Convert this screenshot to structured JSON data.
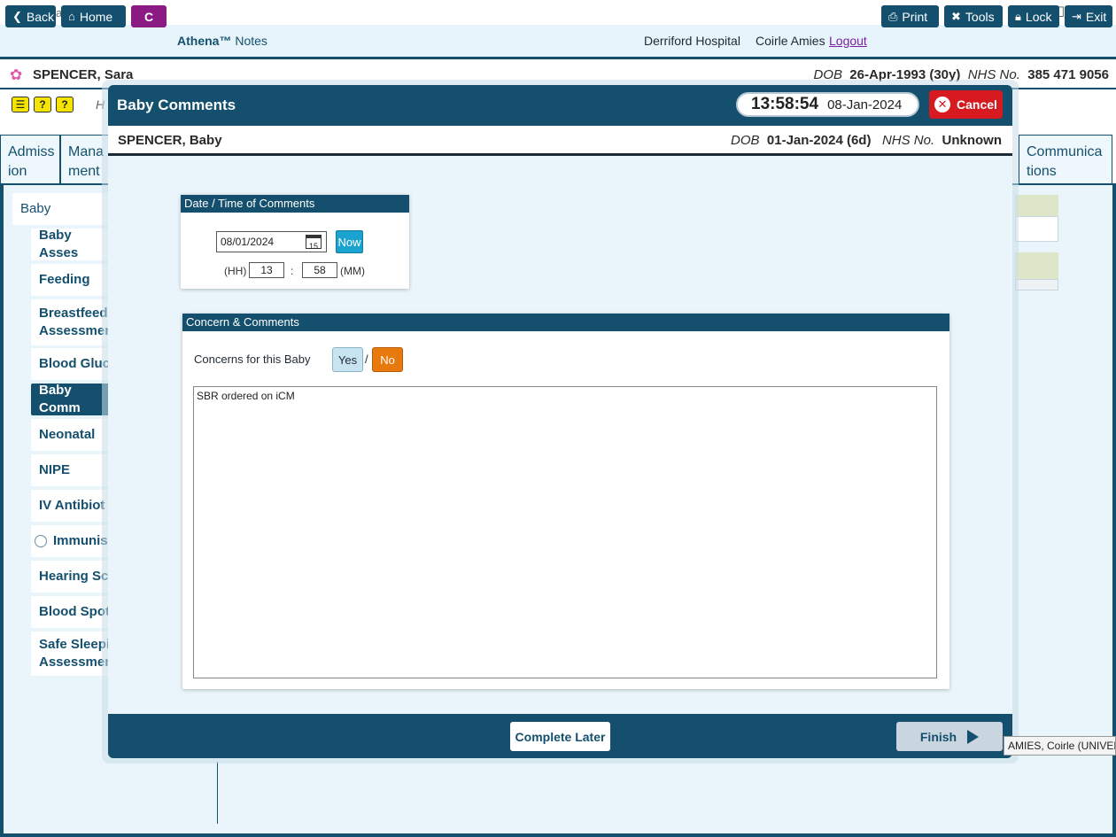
{
  "window": {
    "title": "Athena",
    "minimize": "—",
    "maximize": "☐",
    "close": "✕"
  },
  "toolbar": {
    "back": "Back",
    "home": "Home",
    "c": "C",
    "brand_strong": "Athena™",
    "brand_rest": " Notes",
    "hospital": "Derriford Hospital",
    "user": "Coirle Amies",
    "logout": "Logout",
    "print": "Print",
    "tools": "Tools",
    "lock": "Lock",
    "exit": "Exit"
  },
  "patient": {
    "name": "SPENCER, Sara",
    "dob_label": "DOB",
    "dob": "26-Apr-1993 (30y)",
    "nhs_label": "NHS No.",
    "nhs": "385 471 9056"
  },
  "background": {
    "h_text": "H",
    "tabs": [
      {
        "line1": "Admiss",
        "line2": "ion"
      },
      {
        "line1": "Mana",
        "line2": "ment"
      },
      {
        "line1": "Communica",
        "line2": "tions"
      }
    ],
    "nav": [
      {
        "label": "Baby"
      },
      {
        "label": "Baby Asses"
      },
      {
        "label": "Feeding"
      },
      {
        "label": "Breastfeedi",
        "label2": "Assessmen"
      },
      {
        "label": "Blood Gluc"
      },
      {
        "label": "Baby Comm"
      },
      {
        "label": "Neonatal"
      },
      {
        "label": "NIPE"
      },
      {
        "label": "IV Antibiot"
      },
      {
        "label": "Immunis"
      },
      {
        "label": "Hearing Sc"
      },
      {
        "label": "Blood Spot"
      },
      {
        "label": "Safe Sleepi",
        "label2": "Assessmen"
      }
    ]
  },
  "modal": {
    "title": "Baby Comments",
    "time": "13:58:54",
    "date": "08-Jan-2024",
    "cancel": "Cancel",
    "patient": {
      "name": "SPENCER, Baby",
      "dob_label": "DOB",
      "dob": "01-Jan-2024 (6d)",
      "nhs_label": "NHS No.",
      "nhs": "Unknown"
    },
    "datetime_panel": {
      "title": "Date / Time of Comments",
      "date_value": "08/01/2024",
      "cal_day": "15",
      "now": "Now",
      "hh_label": "(HH)",
      "hh": "13",
      "colon": ":",
      "mm": "58",
      "mm_label": "(MM)"
    },
    "concern_panel": {
      "title": "Concern & Comments",
      "question": "Concerns for this Baby",
      "yes": "Yes",
      "slash": "/",
      "no": "No",
      "comments": "SBR ordered on iCM"
    },
    "complete_later": "Complete Later",
    "finish": "Finish"
  },
  "tooltip": "AMIES, Coirle (UNIVERS",
  "colors": {
    "primary": "#14506e",
    "accent": "#1aa3cf",
    "no_selected": "#e8790c",
    "cancel": "#d71920",
    "c_button": "#8c1a83"
  }
}
